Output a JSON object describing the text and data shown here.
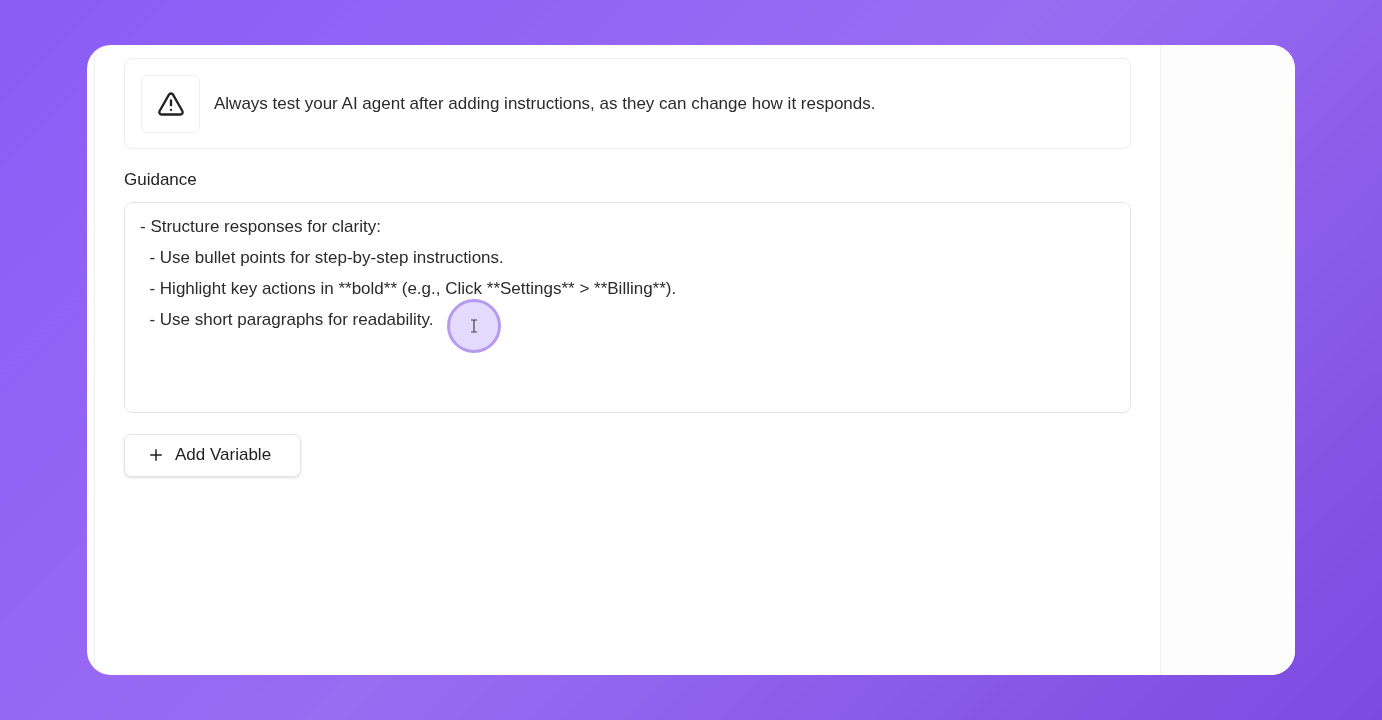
{
  "notice": {
    "text": "Always test your AI agent after adding instructions, as they can change how it responds."
  },
  "guidance": {
    "label": "Guidance",
    "value_lines": [
      "- Structure responses for clarity:",
      "  - Use bullet points for step-by-step instructions.",
      "  - Highlight key actions in **bold** (e.g., Click **Settings** > **Billing**).",
      "  - Use short paragraphs for readability."
    ]
  },
  "add_button": {
    "label": "Add Variable"
  }
}
